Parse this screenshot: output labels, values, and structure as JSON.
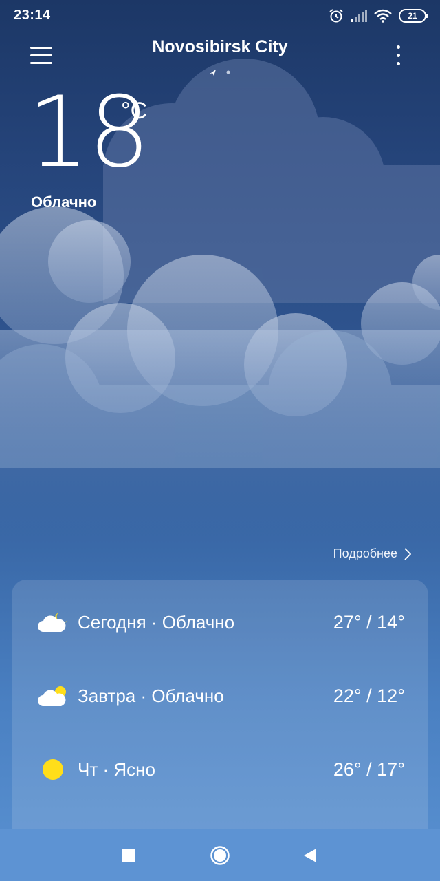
{
  "status_bar": {
    "time": "23:14",
    "battery": "21",
    "icons": [
      "alarm-icon",
      "signal-icon",
      "wifi-icon",
      "battery-icon"
    ]
  },
  "header": {
    "city": "Novosibirsk City",
    "menu_icon": "hamburger-menu-icon",
    "more_icon": "more-vertical-icon"
  },
  "current": {
    "temperature": "18",
    "unit": "°C",
    "condition": "Облачно"
  },
  "details_link": "Подробнее",
  "forecast": [
    {
      "icon": "cloudy-night-icon",
      "label": "Сегодня · Облачно",
      "range": "27° / 14°"
    },
    {
      "icon": "partly-cloudy-icon",
      "label": "Завтра · Облачно",
      "range": "22° / 12°"
    },
    {
      "icon": "sun-icon",
      "label": "Чт · Ясно",
      "range": "26° / 17°"
    }
  ],
  "nav": [
    "recents-button",
    "home-button",
    "back-button"
  ],
  "colors": {
    "sky_top": "#1c3766",
    "sky_bottom": "#5a92d2",
    "sun": "#ffde1a",
    "navbar": "#5d93d3"
  }
}
